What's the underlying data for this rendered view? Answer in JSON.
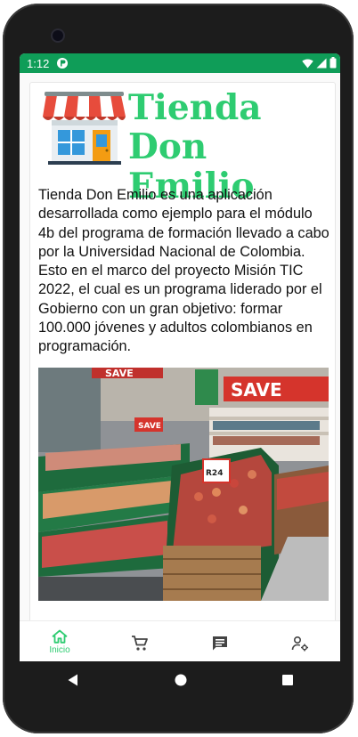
{
  "status_bar": {
    "time": "1:12"
  },
  "app": {
    "title_line1": "Tienda",
    "title_line2": "Don Emilio",
    "description": "Tienda Don Emilio es una aplicación desarrollada como ejemplo para el módulo 4b del programa de formación llevado a cabo por la Universidad Nacional de Colombia. Esto en el marco del proyecto Misión TIC 2022, el cual es un programa liderado por el Gobierno con un gran objetivo: formar 100.000 jóvenes y adultos colombianos en programación."
  },
  "image_signs": {
    "save_top": "SAVE",
    "save_right": "SAVE",
    "save_mid": "SAVE",
    "price_tag": "R24"
  },
  "bottom_nav": {
    "items": [
      {
        "label": "Inicio",
        "icon": "home-icon",
        "active": true
      },
      {
        "label": "",
        "icon": "cart-icon",
        "active": false
      },
      {
        "label": "",
        "icon": "chat-icon",
        "active": false
      },
      {
        "label": "",
        "icon": "user-settings-icon",
        "active": false
      }
    ]
  },
  "colors": {
    "status_bar": "#0f9d58",
    "brand_green": "#2ecc71"
  }
}
